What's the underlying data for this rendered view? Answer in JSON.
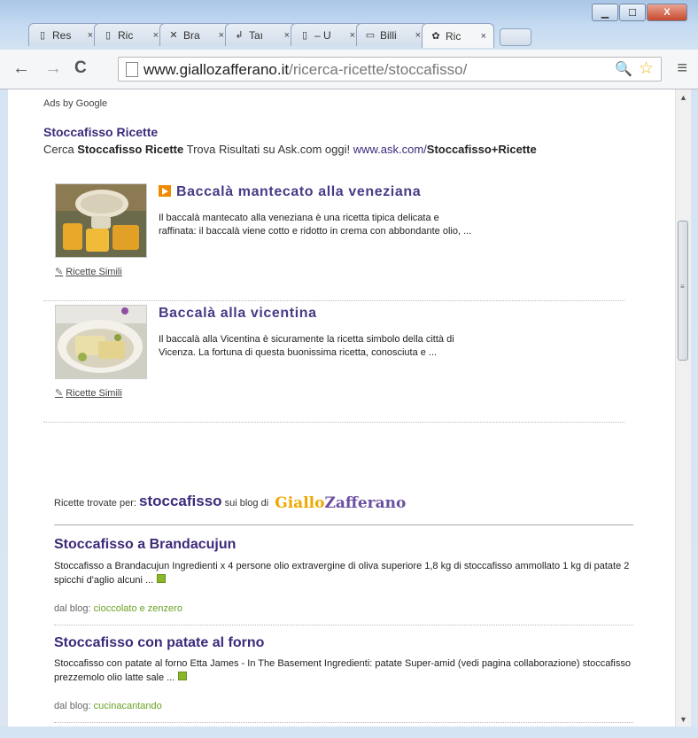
{
  "window": {
    "minimize_icon": "minimize-icon",
    "maximize_icon": "maximize-icon",
    "close_icon": "close-icon",
    "minimize_glyph": "▁",
    "maximize_glyph": "☐",
    "close_glyph": "X"
  },
  "tabs": [
    {
      "title": "Res",
      "icon": "page-icon",
      "glyph": "▯"
    },
    {
      "title": "Ric",
      "icon": "page-icon",
      "glyph": "▯"
    },
    {
      "title": "Bra",
      "icon": "cross-icon",
      "glyph": "✕"
    },
    {
      "title": "Taı",
      "icon": "arrow-icon",
      "glyph": "↲"
    },
    {
      "title": "– U",
      "icon": "page-icon",
      "glyph": "▯"
    },
    {
      "title": "Billi",
      "icon": "cmo-icon",
      "glyph": "▭"
    },
    {
      "title": "Ric",
      "icon": "recipe-icon",
      "glyph": "✿",
      "active": true
    }
  ],
  "tab_close": "×",
  "toolbar": {
    "back": "←",
    "forward": "→",
    "reload": "C",
    "url_domain": "www.giallozafferano.it",
    "url_path": "/ricerca-ricette/stoccafisso/",
    "zoom": "🔍",
    "star": "☆",
    "menu": "≡"
  },
  "scrollbar": {
    "up": "▲",
    "down": "▼",
    "grip": "≡"
  },
  "ads": {
    "label": "Ads by Google",
    "title": "Stoccafisso Ricette",
    "body_pre": "Cerca ",
    "body_bold": "Stoccafisso Ricette",
    "body_mid": " Trova Risultati su Ask.com oggi! ",
    "url_plain": "www.ask.com/",
    "url_bold": "Stoccafisso+Ricette"
  },
  "recipes": [
    {
      "title": "Baccalà mantecato alla veneziana",
      "video": true,
      "desc": "Il baccalà mantecato alla veneziana è una ricetta tipica delicata e raffinata: il baccalà viene cotto e ridotto in crema con abbondante olio, ...",
      "similar": "Ricette Simili"
    },
    {
      "title": "Baccalà alla vicentina",
      "video": false,
      "desc": "Il baccalà alla Vicentina è sicuramente la ricetta simbolo della città di Vicenza. La fortuna di questa buonissima ricetta, conosciuta e ...",
      "similar": "Ricette Simili"
    }
  ],
  "found": {
    "prefix": "Ricette trovate per: ",
    "keyword": "stoccafisso",
    "suffix": " sui blog di ",
    "logo_a": "Giallo",
    "logo_b": "Zafferano"
  },
  "blogs": [
    {
      "title": "Stoccafisso a Brandacujun",
      "desc": "Stoccafisso a Brandacujun   Ingredienti x 4 persone olio extravergine di oliva superiore 1,8 kg di stoccafisso ammollato 1 kg di patate 2 spicchi d'aglio alcuni ...",
      "from_label": "dal blog: ",
      "from": "cioccolato e zenzero"
    },
    {
      "title": "Stoccafisso con patate al forno",
      "desc": "Stoccafisso con patate al forno Etta James - In The Basement Ingredienti: patate Super-amid (vedi pagina collaborazione) stoccafisso prezzemolo olio latte sale ...",
      "from_label": "dal blog: ",
      "from": "cucinacantando"
    }
  ]
}
